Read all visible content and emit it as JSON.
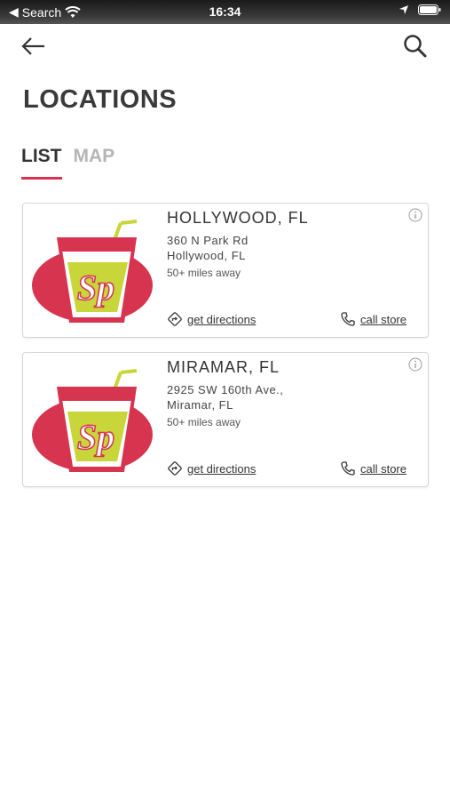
{
  "status_bar": {
    "back_app": "Search",
    "time": "16:34"
  },
  "header": {
    "back_icon": "arrow-left-icon",
    "search_icon": "search-icon"
  },
  "page": {
    "title": "LOCATIONS"
  },
  "tabs": [
    {
      "label": "LIST",
      "active": true
    },
    {
      "label": "MAP",
      "active": false
    }
  ],
  "colors": {
    "accent": "#d6344f",
    "logo_red": "#d6344f",
    "logo_green": "#c8d63a"
  },
  "locations": [
    {
      "name": "HOLLYWOOD, FL",
      "address_line1": "360 N Park Rd",
      "address_line2": "Hollywood, FL",
      "distance": "50+ miles away",
      "directions_label": "get directions",
      "call_label": "call store"
    },
    {
      "name": "MIRAMAR, FL",
      "address_line1": "2925 SW 160th Ave.,",
      "address_line2": "Miramar, FL",
      "distance": "50+ miles away",
      "directions_label": "get directions",
      "call_label": "call store"
    }
  ],
  "logo": {
    "text": "Sp"
  }
}
